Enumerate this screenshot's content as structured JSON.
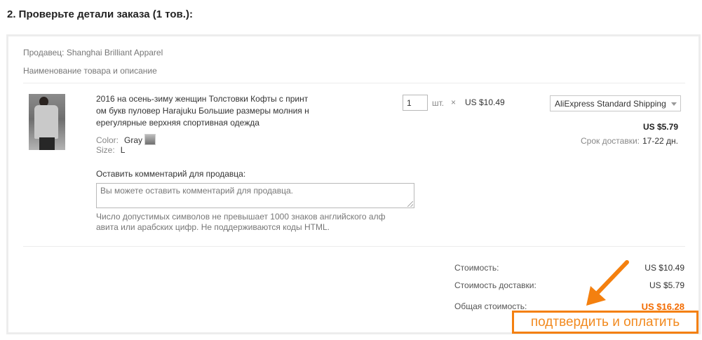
{
  "section": {
    "title": "2. Проверьте детали заказа (1 тов.):"
  },
  "order": {
    "seller": "Продавец: Shanghai Brilliant Apparel",
    "description_header": "Наименование товара и описание",
    "item": {
      "title": "2016 на осень-зиму женщин Толстовки Кофты с принт ом букв пуловер Harajuku Большие размеры молния н ерегулярные верхняя спортивная одежда",
      "color_label": "Color:",
      "color_value": "Gray",
      "size_label": "Size:",
      "size_value": "L",
      "quantity": "1",
      "unit": "шт.",
      "times": "×",
      "unit_price": "US $10.49",
      "shipping_method": "AliExpress Standard Shipping",
      "shipping_cost": "US $5.79",
      "delivery_label": "Срок доставки:",
      "delivery_value": "17-22 дн."
    },
    "comment": {
      "label": "Оставить комментарий для продавца:",
      "placeholder": "Вы можете оставить комментарий для продавца.",
      "hint": "Число допустимых символов не превышает 1000 знаков английского алф авита или арабских цифр. Не поддерживаются коды HTML."
    }
  },
  "summary": {
    "subtotal_label": "Стоимость:",
    "subtotal_value": "US $10.49",
    "shipping_label": "Стоимость доставки:",
    "shipping_value": "US $5.79",
    "total_label": "Общая стоимость:",
    "total_value": "US $16.28"
  },
  "actions": {
    "confirm_pay": "подтвердить и оплатить"
  },
  "colors": {
    "accent_orange": "#f4800f",
    "total_price": "#f36b00"
  },
  "icons": {
    "shipping_dropdown": "chevron-down-icon",
    "annotation": "arrow-pointer-icon"
  }
}
